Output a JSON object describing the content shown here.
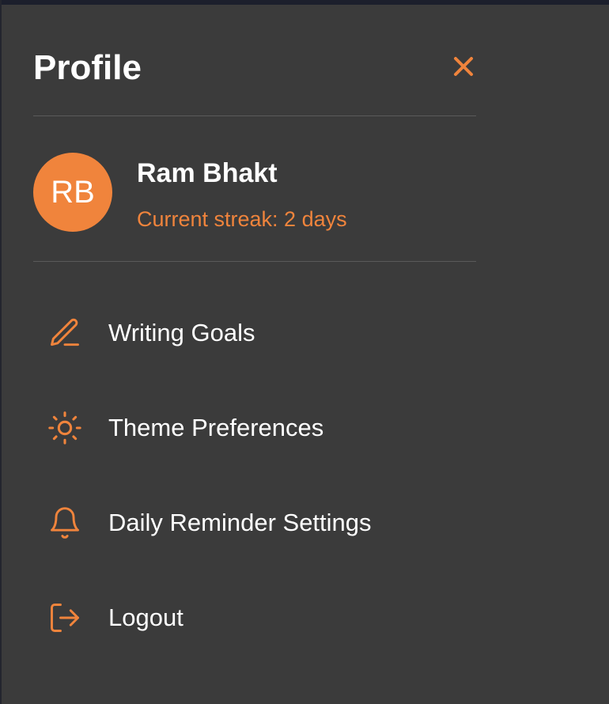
{
  "panel": {
    "title": "Profile",
    "close_icon": "close-icon"
  },
  "user": {
    "initials": "RB",
    "name": "Ram Bhakt",
    "streak": "Current streak: 2 days"
  },
  "menu": {
    "items": [
      {
        "label": "Writing Goals",
        "icon": "pencil-icon"
      },
      {
        "label": "Theme Preferences",
        "icon": "sun-icon"
      },
      {
        "label": "Daily Reminder Settings",
        "icon": "bell-icon"
      },
      {
        "label": "Logout",
        "icon": "logout-icon"
      }
    ]
  },
  "colors": {
    "accent": "#f0843c",
    "background": "#3b3b3b",
    "text": "#ffffff",
    "divider": "#5a5a5a"
  }
}
